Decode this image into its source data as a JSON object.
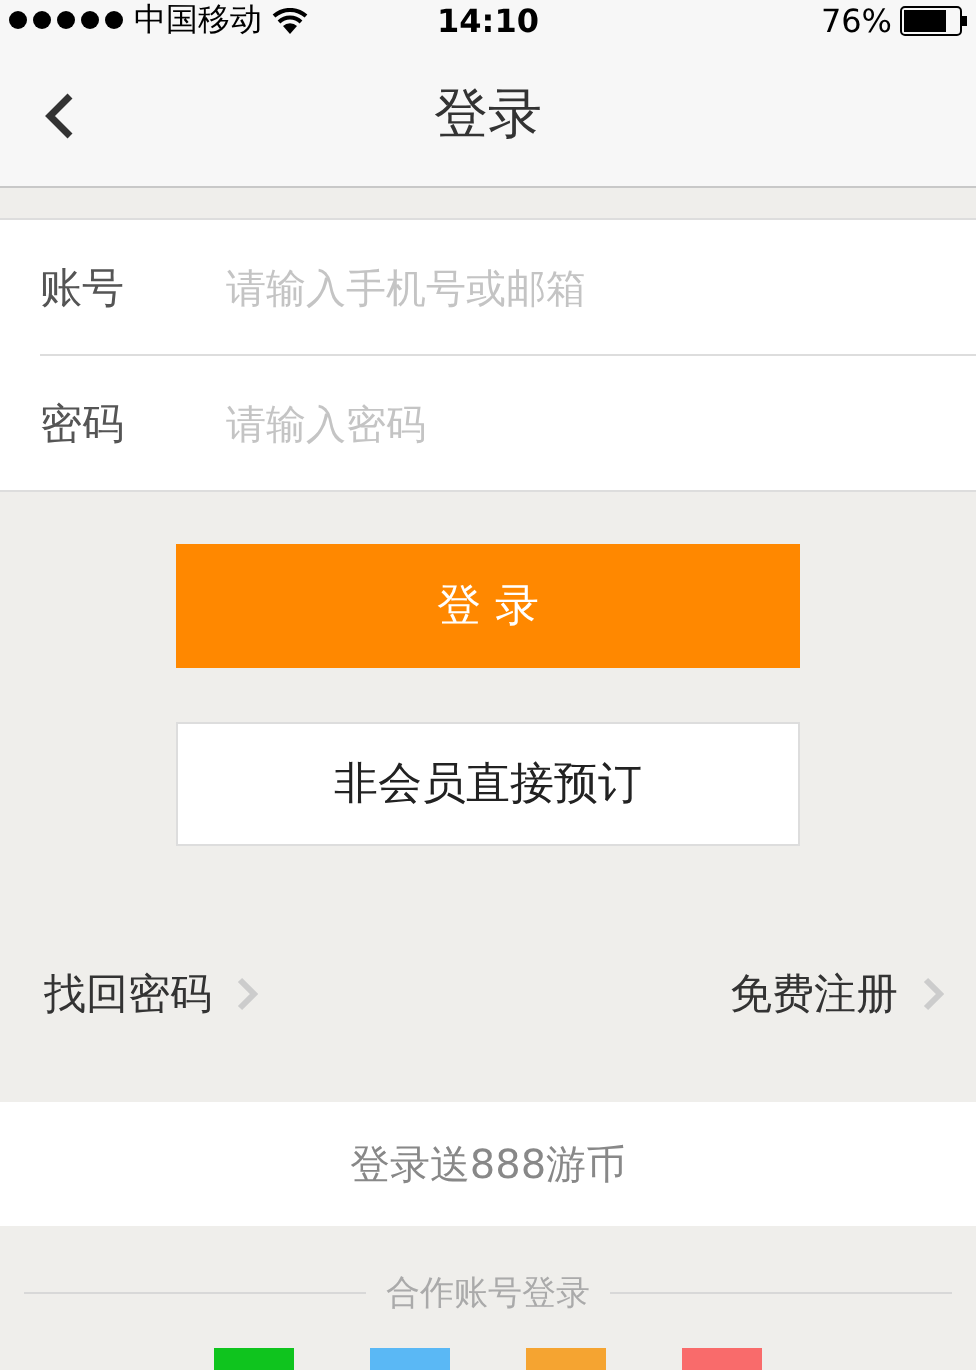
{
  "status_bar": {
    "carrier": "中国移动",
    "time": "14:10",
    "battery": "76%"
  },
  "nav": {
    "title": "登录"
  },
  "form": {
    "fields": [
      {
        "label": "账号",
        "placeholder": "请输入手机号或邮箱"
      },
      {
        "label": "密码",
        "placeholder": "请输入密码"
      }
    ]
  },
  "login_button": "登 录",
  "guest_button": "非会员直接预订",
  "links": [
    {
      "label": "找回密码"
    },
    {
      "label": "免费注册"
    }
  ],
  "promo": "登录送888游币",
  "partner_login": {
    "title": "合作账号登录",
    "partners": [
      {
        "color": "#0fc41e"
      },
      {
        "color": "#5ab8f5"
      },
      {
        "color": "#f5a431"
      },
      {
        "color": "#f96b6b"
      }
    ]
  }
}
